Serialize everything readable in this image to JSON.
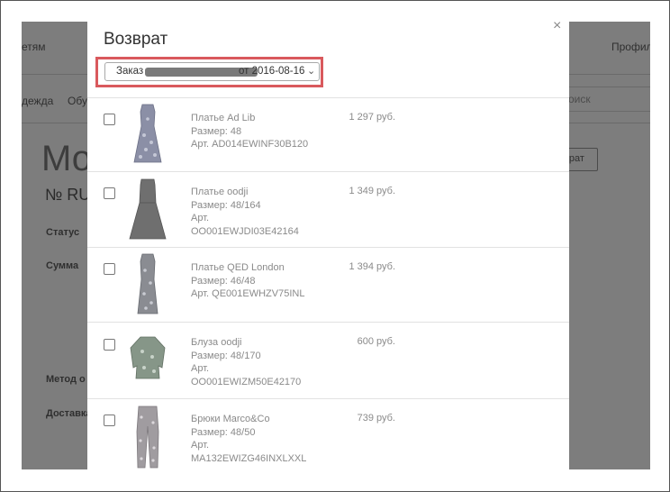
{
  "background_page": {
    "nav_partial": "етям",
    "profile_partial": "Профил",
    "menu_item_1": "дежда",
    "menu_item_2": "Обу",
    "search_partial": "оиск",
    "heading_partial": "Мо",
    "order_number_partial": "№ RU",
    "status_label": "Статус",
    "sum_label": "Сумма",
    "payment_method_label": "Метод о",
    "delivery_label": "Доставка",
    "button_partial": "зврат"
  },
  "modal": {
    "title": "Возврат",
    "close_symbol": "×",
    "order_select": {
      "prefix": "Заказ",
      "suffix": "от 2016-08-16",
      "chevron": "⌄"
    },
    "items": [
      {
        "name": "Платье Ad Lib",
        "size": "Размер: 48",
        "article_label": "Арт. AD014EWINF30B120",
        "article": "",
        "price": "1 297 руб.",
        "image": "patterned-dress"
      },
      {
        "name": "Платье oodji",
        "size": "Размер: 48/164",
        "article_label": "Арт.",
        "article": "OO001EWJDI03E42164",
        "price": "1 349 руб.",
        "image": "grey-dress"
      },
      {
        "name": "Платье QED London",
        "size": "Размер: 46/48",
        "article_label": "Арт. QE001EWHZV75INL",
        "article": "",
        "price": "1 394 руб.",
        "image": "print-dress"
      },
      {
        "name": "Блуза oodji",
        "size": "Размер: 48/170",
        "article_label": "Арт.",
        "article": "OO001EWIZM50E42170",
        "price": "600 руб.",
        "image": "blouse"
      },
      {
        "name": "Брюки Marco&Co",
        "size": "Размер: 48/50",
        "article_label": "Арт.",
        "article": "MA132EWIZG46INXLXXL",
        "price": "739 руб.",
        "image": "trousers"
      }
    ]
  }
}
